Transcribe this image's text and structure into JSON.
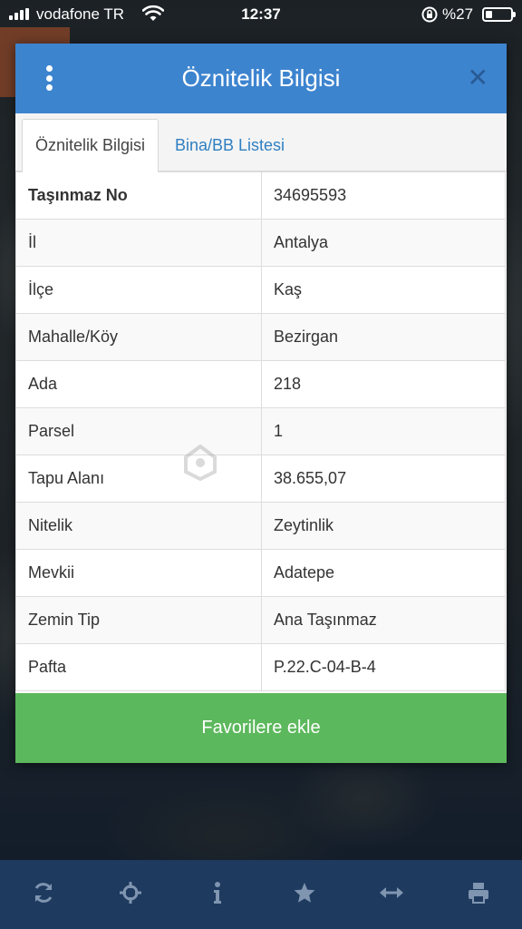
{
  "status_bar": {
    "carrier": "vodafone TR",
    "time": "12:37",
    "battery_percent": "%27",
    "battery_level": 0.27
  },
  "modal": {
    "title": "Öznitelik Bilgisi",
    "tabs": [
      {
        "label": "Öznitelik Bilgisi",
        "active": true
      },
      {
        "label": "Bina/BB Listesi",
        "active": false
      }
    ],
    "rows": [
      {
        "key": "Taşınmaz No",
        "value": "34695593"
      },
      {
        "key": "İl",
        "value": "Antalya"
      },
      {
        "key": "İlçe",
        "value": "Kaş"
      },
      {
        "key": "Mahalle/Köy",
        "value": "Bezirgan"
      },
      {
        "key": "Ada",
        "value": "218"
      },
      {
        "key": "Parsel",
        "value": "1"
      },
      {
        "key": "Tapu Alanı",
        "value": "38.655,07"
      },
      {
        "key": "Nitelik",
        "value": "Zeytinlik"
      },
      {
        "key": "Mevkii",
        "value": "Adatepe"
      },
      {
        "key": "Zemin Tip",
        "value": "Ana Taşınmaz"
      },
      {
        "key": "Pafta",
        "value": "P.22.C-04-B-4"
      }
    ],
    "favorite_button": "Favorilere ekle"
  },
  "watermark": "emlakjet",
  "toolbar": {
    "icons": [
      "refresh-icon",
      "crosshair-icon",
      "info-icon",
      "star-icon",
      "measure-icon",
      "print-icon"
    ]
  },
  "colors": {
    "header": "#3d84cf",
    "button": "#5cb85c",
    "toolbar": "#1e3a5f",
    "tab_link": "#2f7fc1"
  }
}
